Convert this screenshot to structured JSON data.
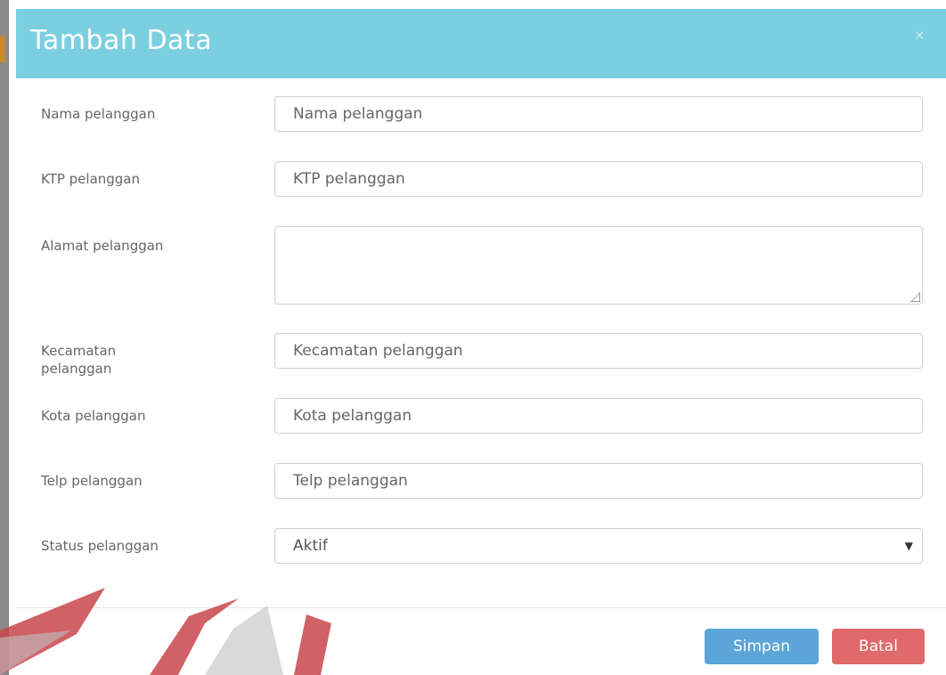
{
  "modal": {
    "title": "Tambah Data",
    "close_icon": "×"
  },
  "form": {
    "fields": [
      {
        "label": "Nama pelanggan",
        "placeholder": "Nama pelanggan",
        "value": ""
      },
      {
        "label": "KTP pelanggan",
        "placeholder": "KTP pelanggan",
        "value": ""
      },
      {
        "label": "Alamat pelanggan",
        "placeholder": "",
        "value": ""
      },
      {
        "label": "Kecamatan pelanggan",
        "placeholder": "Kecamatan pelanggan",
        "value": ""
      },
      {
        "label": "Kota pelanggan",
        "placeholder": "Kota pelanggan",
        "value": ""
      },
      {
        "label": "Telp pelanggan",
        "placeholder": "Telp pelanggan",
        "value": ""
      }
    ],
    "status": {
      "label": "Status pelanggan",
      "selected": "Aktif",
      "caret_icon": "▼"
    }
  },
  "footer": {
    "save_label": "Simpan",
    "cancel_label": "Batal"
  },
  "colors": {
    "header_bg": "#7bcfe0",
    "save_button": "#5ba5d8",
    "cancel_button": "#e06a69",
    "watermark": "#c8454b"
  }
}
